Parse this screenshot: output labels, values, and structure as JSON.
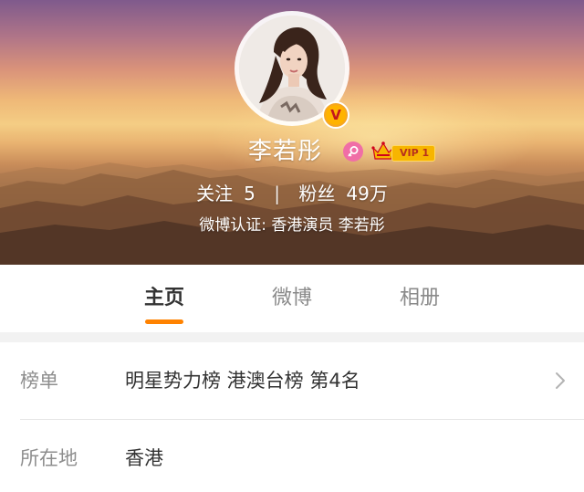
{
  "profile": {
    "name": "李若彤",
    "gender_icon": "female-icon",
    "vip_label": "VIP 1",
    "verified_icon": "verified-v-icon",
    "verified_mark": "V"
  },
  "stats": {
    "following_label": "关注",
    "following_count": "5",
    "separator": "|",
    "followers_label": "粉丝",
    "followers_count": "49万"
  },
  "verification": {
    "text": "微博认证: 香港演员 李若彤"
  },
  "tabs": [
    {
      "label": "主页",
      "active": true
    },
    {
      "label": "微博",
      "active": false
    },
    {
      "label": "相册",
      "active": false
    }
  ],
  "info": [
    {
      "label": "榜单",
      "value": "明星势力榜  港澳台榜  第4名"
    },
    {
      "label": "所在地",
      "value": "香港"
    }
  ],
  "colors": {
    "accent": "#ff8200",
    "verified_badge": "#f5a623",
    "gender": "#f06ea6",
    "vip": "#f7b500"
  }
}
